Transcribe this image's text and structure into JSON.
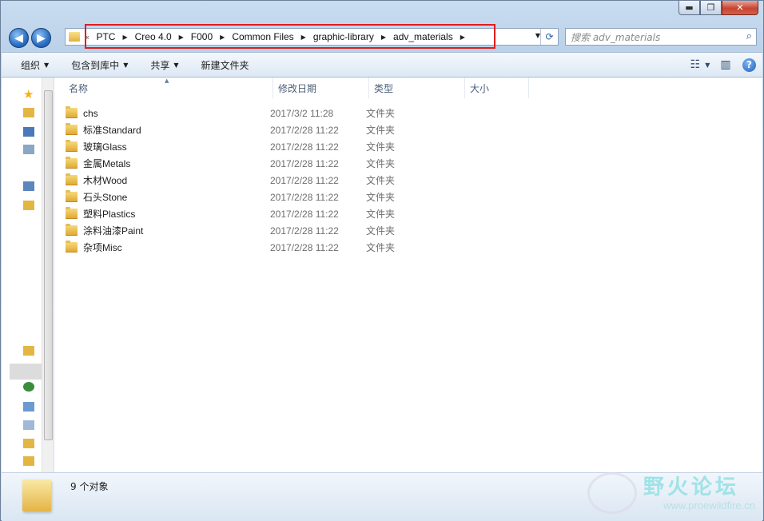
{
  "window": {
    "controls": {
      "minimize": "▬",
      "maximize": "❐",
      "close": "✕"
    }
  },
  "nav": {
    "back": "◀",
    "forward": "▶"
  },
  "address": {
    "lead": "«",
    "crumbs": [
      "PTC",
      "Creo 4.0",
      "F000",
      "Common Files",
      "graphic-library",
      "adv_materials"
    ],
    "dropdown": "▼",
    "refresh": "⟳"
  },
  "search": {
    "placeholder": "搜索 adv_materials",
    "icon": "⌕"
  },
  "toolbar": {
    "organize": "组织",
    "include_in_library": "包含到库中",
    "share": "共享",
    "new_folder": "新建文件夹",
    "view_icon": "☷",
    "preview_icon": "▥",
    "help": "?"
  },
  "columns": {
    "name": "名称",
    "modified": "修改日期",
    "type": "类型",
    "size": "大小"
  },
  "files": [
    {
      "name": "chs",
      "modified": "2017/3/2 11:28",
      "type": "文件夹"
    },
    {
      "name": "标准Standard",
      "modified": "2017/2/28 11:22",
      "type": "文件夹"
    },
    {
      "name": "玻璃Glass",
      "modified": "2017/2/28 11:22",
      "type": "文件夹"
    },
    {
      "name": "金属Metals",
      "modified": "2017/2/28 11:22",
      "type": "文件夹"
    },
    {
      "name": "木材Wood",
      "modified": "2017/2/28 11:22",
      "type": "文件夹"
    },
    {
      "name": "石头Stone",
      "modified": "2017/2/28 11:22",
      "type": "文件夹"
    },
    {
      "name": "塑料Plastics",
      "modified": "2017/2/28 11:22",
      "type": "文件夹"
    },
    {
      "name": "涂料油漆Paint",
      "modified": "2017/2/28 11:22",
      "type": "文件夹"
    },
    {
      "name": "杂项Misc",
      "modified": "2017/2/28 11:22",
      "type": "文件夹"
    }
  ],
  "status": {
    "count": "9 个对象"
  },
  "watermark": {
    "title": "野火论坛",
    "url": "www.proewildfire.cn"
  },
  "colors": {
    "highlight_box": "#e21c1c",
    "window_frame": "#c9dcf0"
  }
}
